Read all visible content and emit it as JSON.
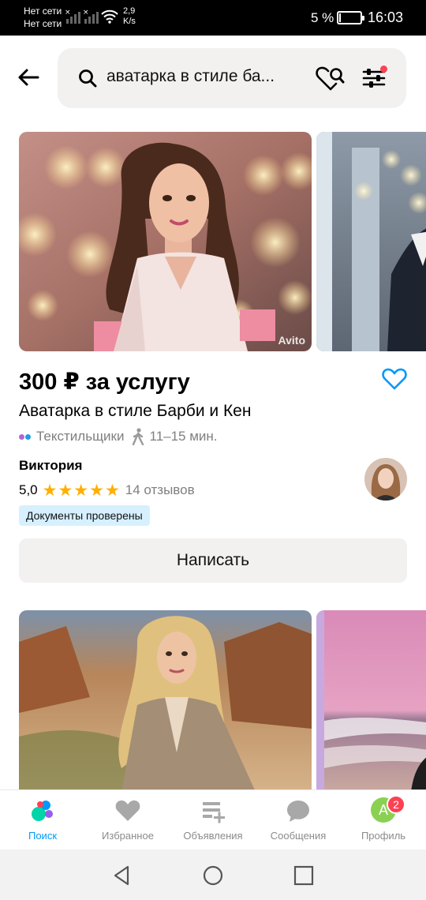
{
  "status_bar": {
    "network_line1": "Нет сети",
    "network_line2": "Нет сети",
    "speed_value": "2,9",
    "speed_unit": "K/s",
    "battery": "5 %",
    "time": "16:03"
  },
  "search": {
    "query": "аватарка в стиле ба...",
    "filters_active": true
  },
  "colors": {
    "accent": "#0099f7",
    "star": "#ffaf00",
    "badge_bg": "#d6f0ff",
    "notification": "#ff4053"
  },
  "watermark": "Avito",
  "listing": {
    "price": "300 ₽ за услугу",
    "title": "Аватарка в стиле Барби и Кен",
    "metro": "Текстильщики",
    "walk_time": "11–15 мин.",
    "seller": "Виктория",
    "rating": "5,0",
    "stars": 5,
    "reviews": "14 отзывов",
    "badge": "Документы проверены",
    "button": "Написать"
  },
  "bottom_nav": {
    "items": [
      {
        "label": "Поиск",
        "icon": "search-dots-icon",
        "active": true
      },
      {
        "label": "Избранное",
        "icon": "heart-icon",
        "active": false
      },
      {
        "label": "Объявления",
        "icon": "ads-add-icon",
        "active": false
      },
      {
        "label": "Сообщения",
        "icon": "chat-bubble-icon",
        "active": false
      },
      {
        "label": "Профиль",
        "icon": "profile-avatar",
        "active": false
      }
    ],
    "profile_initial": "А",
    "profile_badge": "2"
  }
}
